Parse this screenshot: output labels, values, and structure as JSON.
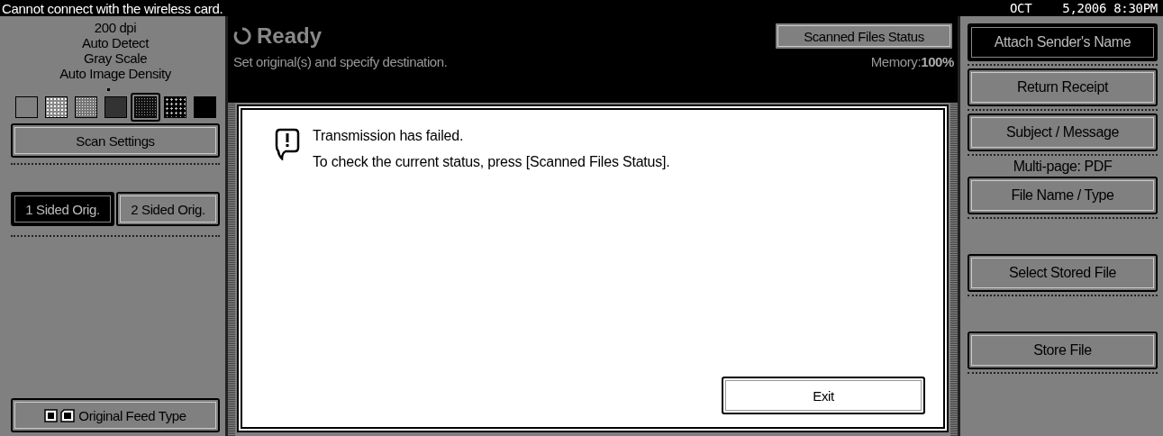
{
  "status_bar": {
    "message": "Cannot connect with the wireless card.",
    "month": "OCT",
    "date_time": "5,2006  8:30PM"
  },
  "left_panel": {
    "settings": [
      "200 dpi",
      "Auto Detect",
      "Gray Scale",
      "Auto Image Density"
    ],
    "density_levels": [
      {
        "kind": "blank",
        "selected": false
      },
      {
        "kind": "sparse",
        "selected": false
      },
      {
        "kind": "medium",
        "selected": false
      },
      {
        "kind": "fine",
        "selected": false
      },
      {
        "kind": "dense",
        "selected": true
      },
      {
        "kind": "dots",
        "selected": false
      },
      {
        "kind": "solid",
        "selected": false
      }
    ],
    "scan_settings_button": "Scan Settings",
    "sided_options": [
      {
        "label": "1 Sided Orig.",
        "selected": true
      },
      {
        "label": "2 Sided Orig.",
        "selected": false
      }
    ],
    "feed_type_button": "Original Feed Type"
  },
  "header": {
    "title": "Ready",
    "scanned_files_button": "Scanned Files Status",
    "instruction": "Set original(s) and specify destination.",
    "memory": "Memory:**100%**"
  },
  "dialog": {
    "lines": [
      "Transmission has failed.",
      "To check the current status, press [Scanned Files Status]."
    ],
    "exit_button": "Exit"
  },
  "right_panel": [
    {
      "kind": "button",
      "label": "Attach Sender's Name",
      "selected": true
    },
    {
      "kind": "button",
      "label": "Return Receipt",
      "selected": false
    },
    {
      "kind": "button",
      "label": "Subject / Message",
      "selected": false
    },
    {
      "kind": "label",
      "label": "Multi-page: PDF"
    },
    {
      "kind": "button",
      "label": "File Name / Type",
      "selected": false
    },
    {
      "kind": "gap"
    },
    {
      "kind": "button",
      "label": "Select Stored File",
      "selected": false
    },
    {
      "kind": "gap"
    },
    {
      "kind": "button",
      "label": "Store File",
      "selected": false
    }
  ]
}
